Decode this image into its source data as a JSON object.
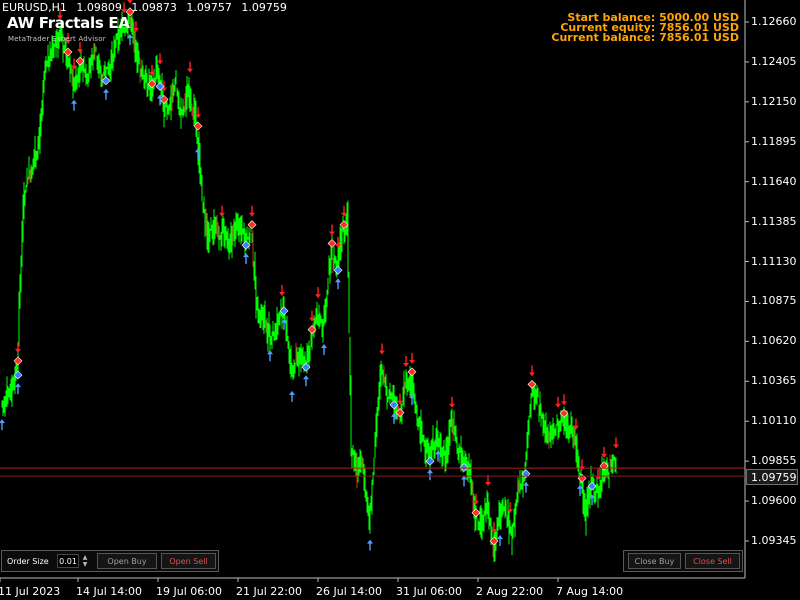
{
  "header": {
    "symbol": "EURUSD,H1",
    "open": "1.09809",
    "high": "1.09873",
    "low": "1.09757",
    "close": "1.09759",
    "ea_name": "AW Fractals EA",
    "ea_subtitle": "MetaTrader Expert Advisor"
  },
  "balance": {
    "start": "Start balance: 5000.00  USD",
    "equity": "Current equity: 7856.01  USD",
    "current": "Current balance: 7856.01  USD"
  },
  "price_axis": [
    "1.12660",
    "1.12405",
    "1.12150",
    "1.11895",
    "1.11640",
    "1.11385",
    "1.11130",
    "1.10875",
    "1.10620",
    "1.10365",
    "1.10110",
    "1.09855",
    "1.09600",
    "1.09345"
  ],
  "current_price": "1.09759",
  "time_axis": [
    "11 Jul 2023",
    "14 Jul 14:00",
    "19 Jul 06:00",
    "21 Jul 22:00",
    "26 Jul 14:00",
    "31 Jul 06:00",
    "2 Aug 22:00",
    "7 Aug 14:00"
  ],
  "order_panel": {
    "label": "Order Size",
    "value": "0.01",
    "open_buy": "Open Buy",
    "open_sell": "Open Sell"
  },
  "close_panel": {
    "close_buy": "Close Buy",
    "close_sell": "Close Sell"
  },
  "colors": {
    "background": "#000000",
    "candle_bull": "#00ff00",
    "candle_bear": "#00ff00",
    "up_fractal": "#ff2020",
    "down_fractal": "#4aa0ff",
    "balance_text": "#ffa500",
    "price_line": "#ff3030"
  },
  "chart_data": {
    "type": "line",
    "price_path": [
      [
        0,
        1.1022
      ],
      [
        8,
        1.1028
      ],
      [
        16,
        1.1045
      ],
      [
        22,
        1.1152
      ],
      [
        30,
        1.1175
      ],
      [
        38,
        1.119
      ],
      [
        44,
        1.1235
      ],
      [
        52,
        1.125
      ],
      [
        58,
        1.1258
      ],
      [
        65,
        1.1245
      ],
      [
        72,
        1.1226
      ],
      [
        80,
        1.124
      ],
      [
        86,
        1.1232
      ],
      [
        94,
        1.1248
      ],
      [
        100,
        1.123
      ],
      [
        108,
        1.1236
      ],
      [
        114,
        1.1252
      ],
      [
        122,
        1.1262
      ],
      [
        128,
        1.1268
      ],
      [
        134,
        1.125
      ],
      [
        140,
        1.1234
      ],
      [
        146,
        1.1228
      ],
      [
        150,
        1.1222
      ],
      [
        156,
        1.1238
      ],
      [
        162,
        1.1212
      ],
      [
        168,
        1.1212
      ],
      [
        174,
        1.1226
      ],
      [
        180,
        1.1206
      ],
      [
        188,
        1.1224
      ],
      [
        196,
        1.1195
      ],
      [
        200,
        1.116
      ],
      [
        206,
        1.113
      ],
      [
        212,
        1.1134
      ],
      [
        220,
        1.1132
      ],
      [
        228,
        1.1125
      ],
      [
        236,
        1.1136
      ],
      [
        244,
        1.1128
      ],
      [
        250,
        1.1132
      ],
      [
        256,
        1.108
      ],
      [
        262,
        1.108
      ],
      [
        268,
        1.1066
      ],
      [
        276,
        1.1072
      ],
      [
        282,
        1.1086
      ],
      [
        290,
        1.104
      ],
      [
        296,
        1.1052
      ],
      [
        304,
        1.105
      ],
      [
        310,
        1.1065
      ],
      [
        316,
        1.108
      ],
      [
        322,
        1.107
      ],
      [
        330,
        1.112
      ],
      [
        336,
        1.1112
      ],
      [
        340,
        1.1128
      ],
      [
        346,
        1.114
      ],
      [
        350,
        1.0995
      ],
      [
        356,
        1.098
      ],
      [
        362,
        1.0984
      ],
      [
        368,
        1.0945
      ],
      [
        374,
        1.1
      ],
      [
        380,
        1.1044
      ],
      [
        386,
        1.103
      ],
      [
        392,
        1.1026
      ],
      [
        398,
        1.1012
      ],
      [
        404,
        1.1036
      ],
      [
        410,
        1.1038
      ],
      [
        416,
        1.101
      ],
      [
        422,
        1.1
      ],
      [
        428,
        1.099
      ],
      [
        436,
        1.1002
      ],
      [
        444,
        1.0985
      ],
      [
        450,
        1.101
      ],
      [
        456,
        1.0994
      ],
      [
        462,
        1.0986
      ],
      [
        468,
        1.0984
      ],
      [
        474,
        1.0948
      ],
      [
        480,
        1.0946
      ],
      [
        486,
        1.096
      ],
      [
        492,
        1.093
      ],
      [
        498,
        1.0948
      ],
      [
        504,
        1.0956
      ],
      [
        510,
        1.0936
      ],
      [
        516,
        1.0962
      ],
      [
        524,
        1.0982
      ],
      [
        530,
        1.103
      ],
      [
        536,
        1.1028
      ],
      [
        542,
        1.1008
      ],
      [
        548,
        1.1
      ],
      [
        556,
        1.101
      ],
      [
        564,
        1.1012
      ],
      [
        572,
        1.1004
      ],
      [
        578,
        1.098
      ],
      [
        584,
        1.095
      ],
      [
        590,
        1.0974
      ],
      [
        596,
        1.0964
      ],
      [
        602,
        1.0978
      ],
      [
        608,
        1.098
      ],
      [
        614,
        1.0984
      ]
    ],
    "up_fractals_x": [
      16,
      58,
      66,
      72,
      78,
      122,
      128,
      134,
      150,
      158,
      162,
      188,
      196,
      220,
      250,
      280,
      310,
      316,
      330,
      336,
      342,
      380,
      398,
      404,
      410,
      450,
      474,
      486,
      492,
      508,
      530,
      556,
      562,
      574,
      580,
      596,
      602,
      614
    ],
    "down_fractals_x": [
      0,
      16,
      72,
      104,
      128,
      158,
      196,
      244,
      268,
      282,
      290,
      304,
      322,
      336,
      368,
      392,
      410,
      428,
      436,
      462,
      498,
      524,
      578,
      590
    ],
    "ylim": [
      1.0922,
      1.1275
    ],
    "current_price_value": 1.09759
  }
}
